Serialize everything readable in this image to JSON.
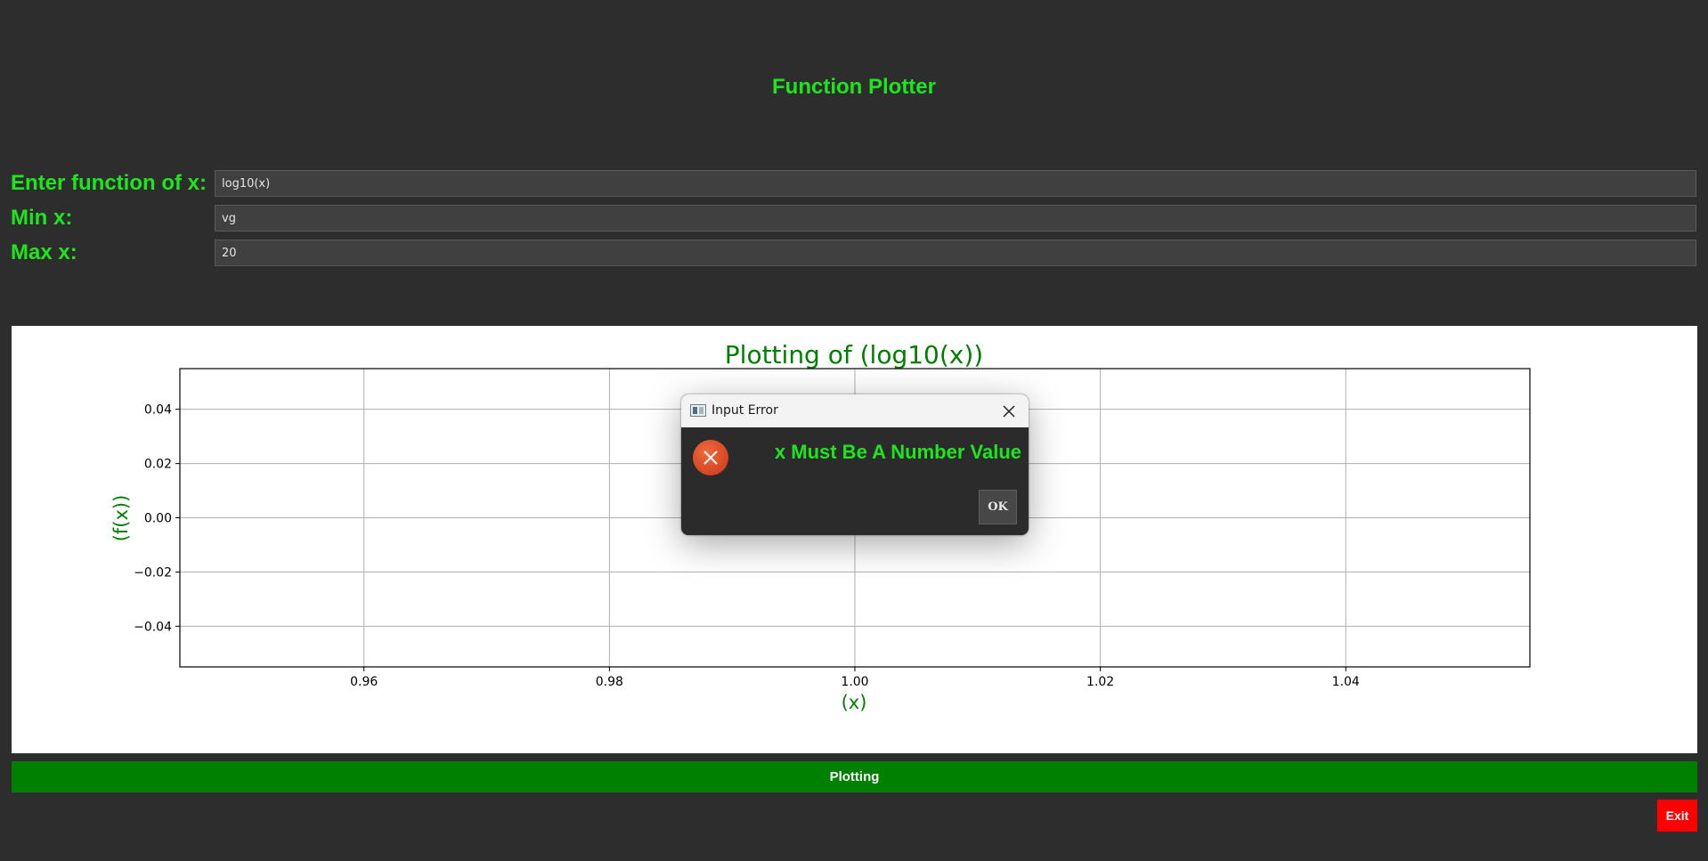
{
  "app": {
    "title": "Function Plotter"
  },
  "form": {
    "function_label": "Enter function of x:",
    "function_value": "log10(x)",
    "min_label": "Min x:",
    "min_value": "vg",
    "max_label": "Max x:",
    "max_value": "20"
  },
  "buttons": {
    "plot_label": "Plotting",
    "exit_label": "Exit"
  },
  "dialog": {
    "title": "Input Error",
    "message": "x Must Be A Number Value",
    "ok_label": "OK",
    "icon": "error-icon"
  },
  "colors": {
    "background": "#2d2d2d",
    "accent_green": "#1ee61e",
    "plot_button": "#008000",
    "exit_button": "#ff0000",
    "chart_text_green": "#008000"
  },
  "chart_data": {
    "type": "line",
    "title": "Plotting of (log10(x))",
    "xlabel": "(x)",
    "ylabel": "(f(x))",
    "xlim": [
      0.945,
      1.055
    ],
    "ylim": [
      -0.055,
      0.055
    ],
    "xticks": [
      0.96,
      0.98,
      1.0,
      1.02,
      1.04
    ],
    "xtick_labels": [
      "0.96",
      "0.98",
      "1.00",
      "1.02",
      "1.04"
    ],
    "yticks": [
      0.04,
      0.02,
      0.0,
      -0.02,
      -0.04
    ],
    "ytick_labels": [
      "0.04",
      "0.02",
      "0.00",
      "−0.02",
      "−0.04"
    ],
    "grid": true,
    "series": [
      {
        "x": [],
        "y": []
      }
    ]
  }
}
